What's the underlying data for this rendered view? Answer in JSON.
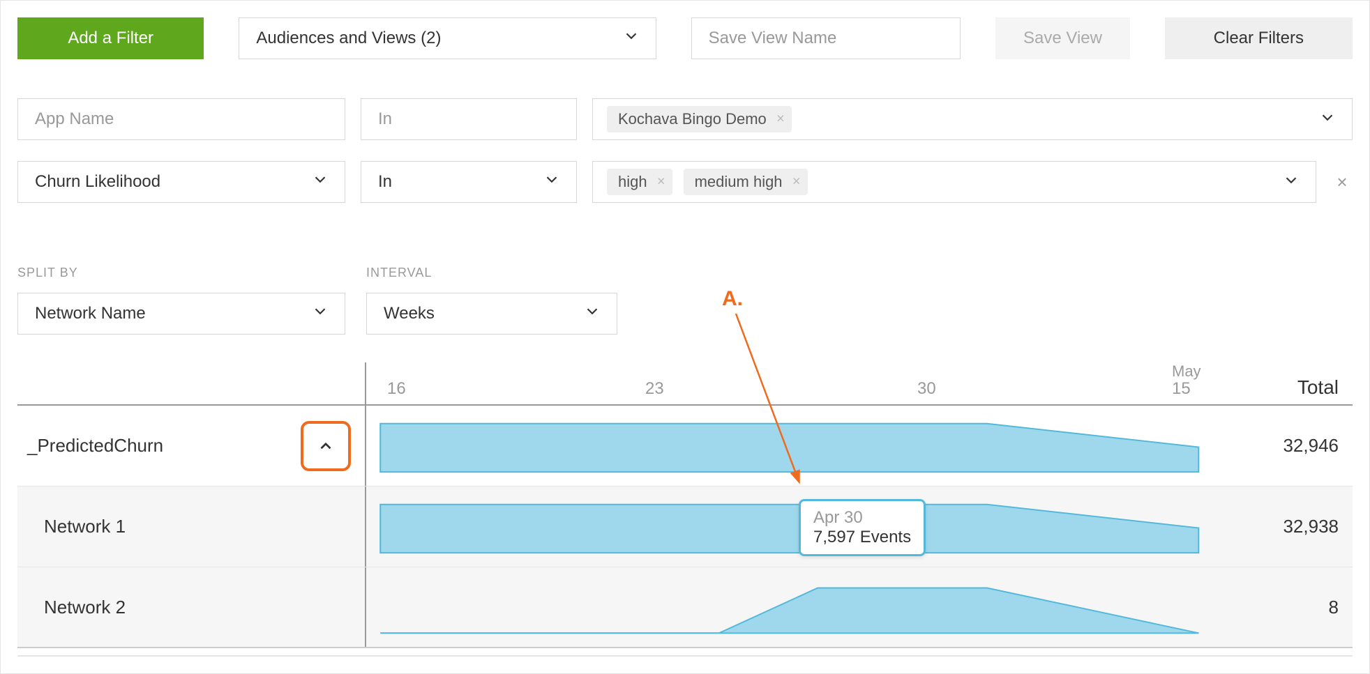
{
  "topbar": {
    "add_filter": "Add a Filter",
    "audiences": "Audiences and Views (2)",
    "save_view_placeholder": "Save View Name",
    "save_view_btn": "Save View",
    "clear_filters": "Clear Filters"
  },
  "filters": [
    {
      "field": "App Name",
      "op": "In",
      "tags": [
        "Kochava Bingo Demo"
      ],
      "removable": false,
      "field_dropdown": false,
      "op_dropdown": false
    },
    {
      "field": "Churn Likelihood",
      "op": "In",
      "tags": [
        "high",
        "medium high"
      ],
      "removable": true,
      "field_dropdown": true,
      "op_dropdown": true
    }
  ],
  "split": {
    "split_by_label": "SPLIT BY",
    "split_by_value": "Network Name",
    "interval_label": "INTERVAL",
    "interval_value": "Weeks"
  },
  "axis": {
    "ticks": [
      "16",
      "23",
      "30"
    ],
    "month": "May",
    "month_day": "15",
    "total_label": "Total"
  },
  "rows": [
    {
      "name": "_PredictedChurn",
      "total": "32,946",
      "expandable": true
    },
    {
      "name": "Network 1",
      "total": "32,938",
      "sub": true
    },
    {
      "name": "Network 2",
      "total": "8",
      "sub": true
    }
  ],
  "tooltip": {
    "date": "Apr 30",
    "events": "7,597 Events"
  },
  "annotation": {
    "label": "A."
  },
  "chart_data": {
    "type": "area",
    "title": "",
    "xlabel": "",
    "ylabel": "",
    "x": [
      "Apr 16",
      "Apr 23",
      "Apr 30",
      "May 15"
    ],
    "series": [
      {
        "name": "_PredictedChurn",
        "values": [
          7600,
          7600,
          7600,
          4800
        ],
        "total": 32946
      },
      {
        "name": "Network 1",
        "values": [
          7597,
          7597,
          7597,
          4800
        ],
        "total": 32938
      },
      {
        "name": "Network 2",
        "values": [
          0,
          0,
          3,
          0
        ],
        "total": 8
      }
    ],
    "tooltip_point": {
      "series": "Network 1",
      "x": "Apr 30",
      "value": 7597
    }
  }
}
